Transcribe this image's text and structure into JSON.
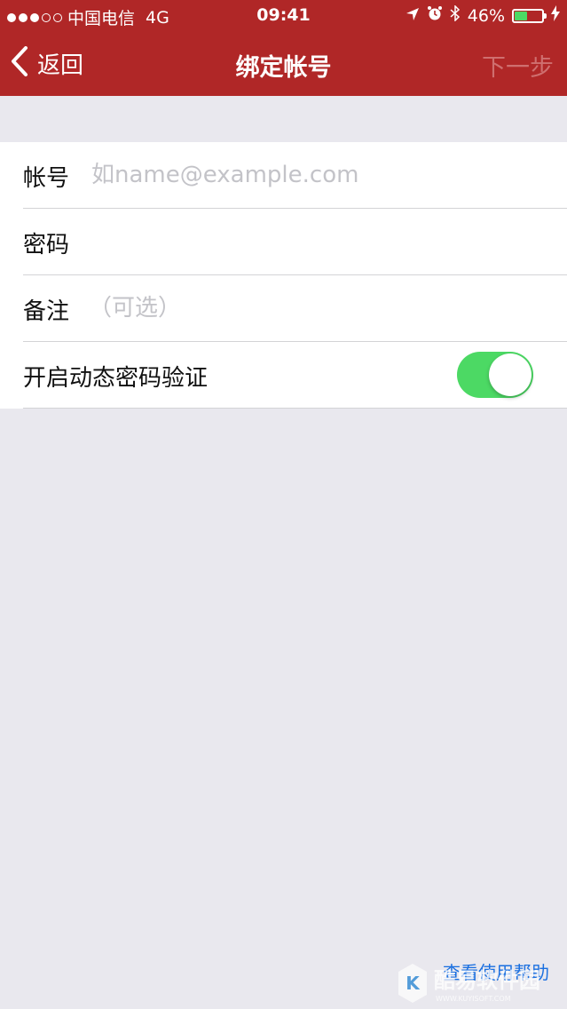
{
  "status_bar": {
    "carrier": "中国电信",
    "network": "4G",
    "time": "09:41",
    "battery_percent_label": "46%",
    "battery_level": 0.46,
    "battery_color": "#4cd964",
    "signal_icons": [
      "signal-dots-icon"
    ],
    "status_icons": [
      "location-icon",
      "alarm-icon",
      "bluetooth-icon",
      "charging-icon"
    ]
  },
  "navbar": {
    "back_label": "返回",
    "title": "绑定帐号",
    "next_label": "下一步",
    "bar_color": "#b02727"
  },
  "form": {
    "account": {
      "label": "帐号",
      "placeholder": "如name@example.com",
      "value": ""
    },
    "password": {
      "label": "密码",
      "placeholder": "",
      "value": ""
    },
    "note": {
      "label": "备注",
      "placeholder": "（可选）",
      "value": ""
    },
    "dynamic_password": {
      "label": "开启动态密码验证",
      "enabled": true,
      "toggle_color": "#4cd964"
    }
  },
  "help_link": {
    "label": "查看使用帮助"
  },
  "watermark": {
    "text": "酷易软件园",
    "subtext": "WWW.KUYISOFT.COM"
  }
}
